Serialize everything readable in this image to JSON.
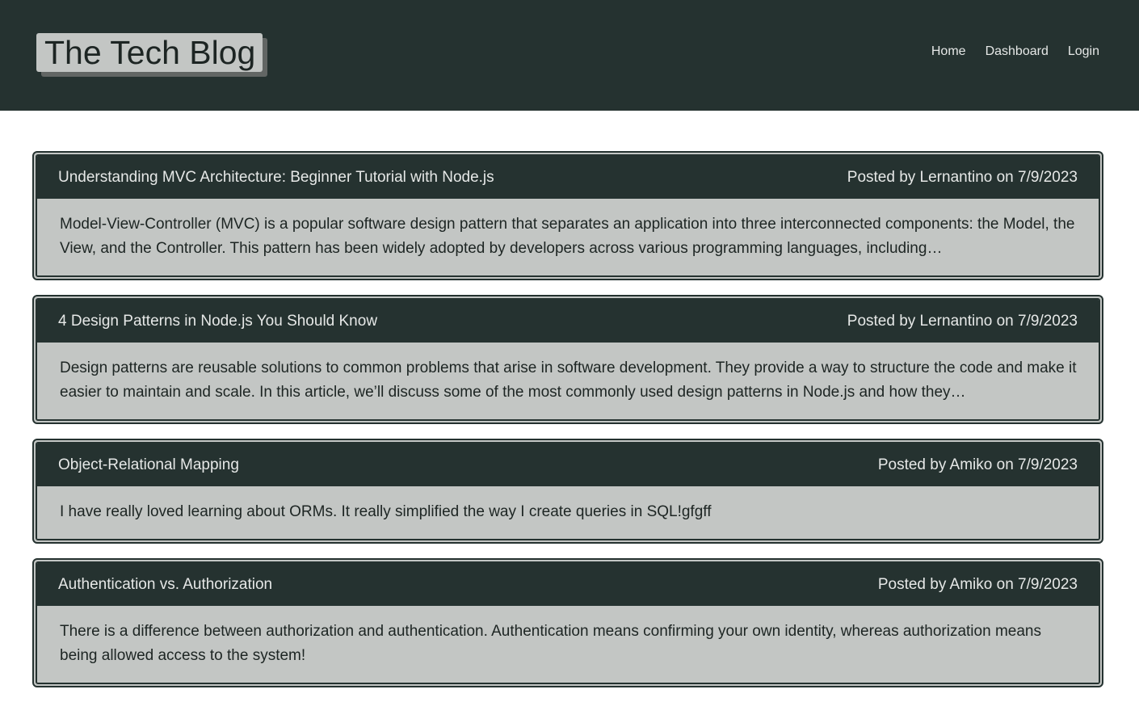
{
  "header": {
    "title": "The Tech Blog",
    "nav": [
      "Home",
      "Dashboard",
      "Login"
    ]
  },
  "posts": [
    {
      "title": "Understanding MVC Architecture: Beginner Tutorial with Node.js",
      "meta": "Posted by Lernantino on 7/9/2023",
      "body": "Model-View-Controller (MVC) is a popular software design pattern that separates an application into three interconnected components: the Model, the View, and the Controller. This pattern has been widely adopted by developers across various programming languages, including…"
    },
    {
      "title": "4 Design Patterns in Node.js You Should Know",
      "meta": "Posted by Lernantino on 7/9/2023",
      "body": "Design patterns are reusable solutions to common problems that arise in software development. They provide a way to structure the code and make it easier to maintain and scale. In this article, we’ll discuss some of the most commonly used design patterns in Node.js and how they…"
    },
    {
      "title": "Object-Relational Mapping",
      "meta": "Posted by Amiko on 7/9/2023",
      "body": "I have really loved learning about ORMs. It really simplified the way I create queries in SQL!gfgff"
    },
    {
      "title": "Authentication vs. Authorization",
      "meta": "Posted by Amiko on 7/9/2023",
      "body": "There is a difference between authorization and authentication. Authentication means confirming your own identity, whereas authorization means being allowed access to the system!"
    }
  ],
  "colors": {
    "header_bg": "#253230",
    "card_bg": "#c3c6c4",
    "text_light": "#e6e8e7",
    "text_dark": "#1d2523"
  }
}
